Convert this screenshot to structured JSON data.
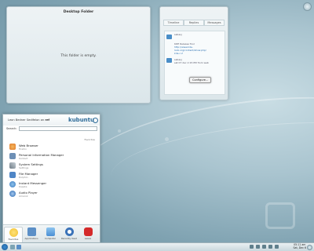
{
  "desktop": {
    "folder_view": {
      "title": "Desktop Folder",
      "empty_message": "This folder is empty."
    },
    "twitter": {
      "tabs": [
        "Timeline",
        "Replies",
        "Messages"
      ],
      "items": [
        {
          "user": "sebasj",
          "lines": [
            "KDE Release Tool",
            "http://www.kde-look.org/content/show.php/",
            "kde.c.2"
          ]
        },
        {
          "user": "sebasj",
          "lines": [
            "sat 07 dec 2:15 PM from web"
          ]
        }
      ],
      "configure_button": "Configure..."
    }
  },
  "kickoff": {
    "user_label": "Leon",
    "user_text": "Leon Bedner Sedifelon",
    "host": "ref",
    "brand": "kubuntu",
    "search_label": "Search:",
    "search_placeholder": "",
    "favorites_header": "Favorites",
    "apps": [
      {
        "name": "Web Browser",
        "category": "Firefox",
        "color": "#e27a2b"
      },
      {
        "name": "Personal Information Manager",
        "category": "Kontact",
        "color": "#6d8fb5"
      },
      {
        "name": "System Settings",
        "category": "Settings",
        "color": "#6f7c86"
      },
      {
        "name": "File Manager",
        "category": "Dolphin",
        "color": "#4f86c6"
      },
      {
        "name": "Instant Messenger",
        "category": "Kopete",
        "color": "#3c7bc0"
      },
      {
        "name": "Audio Player",
        "category": "Amarok",
        "color": "#2b69b1"
      }
    ],
    "tabs": [
      {
        "label": "Favorites",
        "color": "#f0c030"
      },
      {
        "label": "Applications",
        "color": "#5b8fc7"
      },
      {
        "label": "Computer",
        "color": "#4a8fd4"
      },
      {
        "label": "Recently Used",
        "color": "#3b73b8"
      },
      {
        "label": "Leave",
        "color": "#d42a2a"
      }
    ]
  },
  "panel": {
    "clock_time": "05:11 am",
    "clock_date": "Sat, Dec 6"
  }
}
